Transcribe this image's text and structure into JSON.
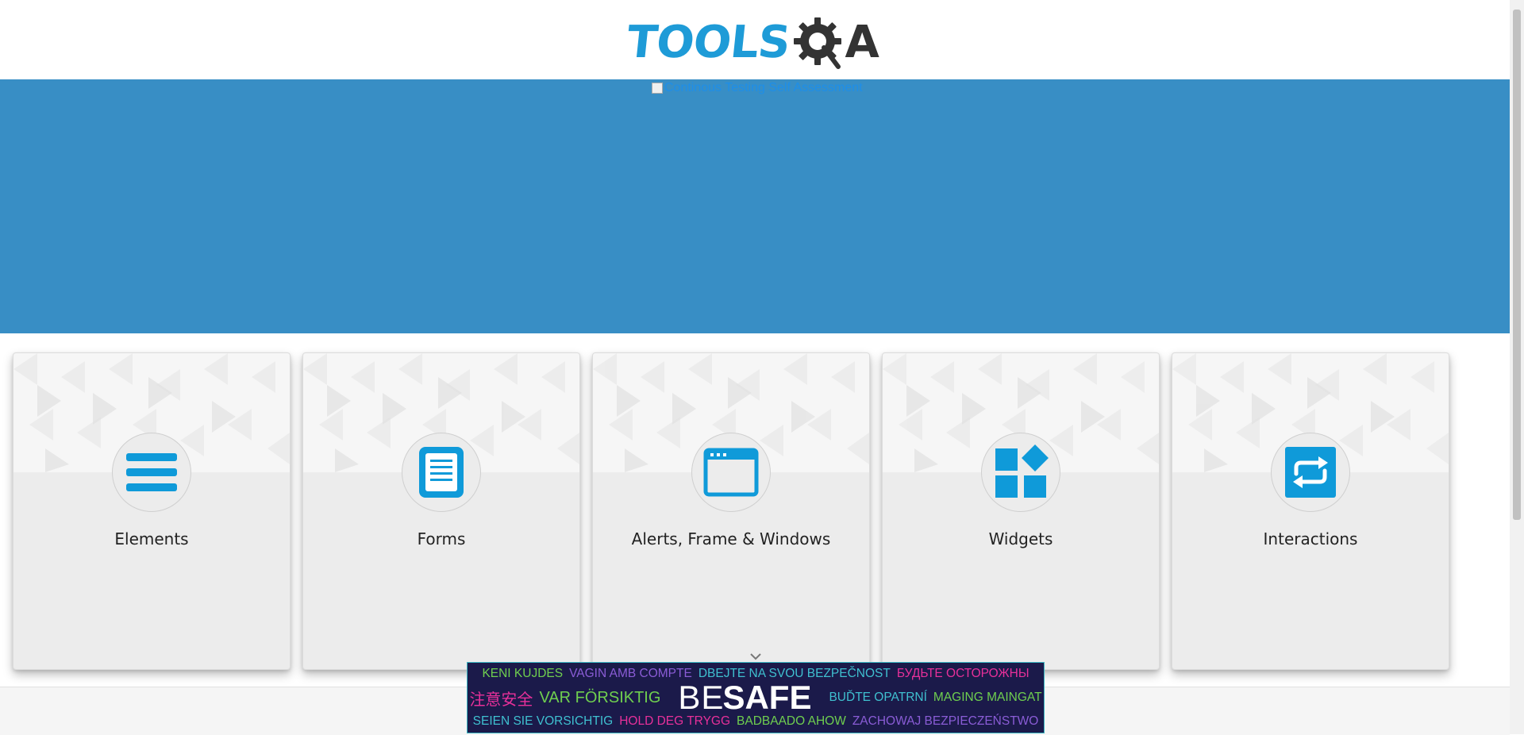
{
  "header": {
    "logo_text": "TOOLS",
    "logo_suffix": "A"
  },
  "banner": {
    "image_alt": "Continous Testing Self Assessment"
  },
  "cards": [
    {
      "title": "Elements",
      "icon": "hamburger-list-icon"
    },
    {
      "title": "Forms",
      "icon": "document-form-icon"
    },
    {
      "title": "Alerts, Frame & Windows",
      "icon": "browser-window-icon"
    },
    {
      "title": "Widgets",
      "icon": "widgets-blocks-icon"
    },
    {
      "title": "Interactions",
      "icon": "repeat-arrows-icon"
    }
  ],
  "ad": {
    "row1": [
      {
        "text": "KENI KUJDES",
        "color": "#6fcf4f"
      },
      {
        "text": "VAGIN AMB COMPTE",
        "color": "#8a5cd6"
      },
      {
        "text": "DBEJTE NA SVOU BEZPEČNOST",
        "color": "#3fc0d0"
      },
      {
        "text": "БУДЬТЕ ОСТОРОЖНЫ",
        "color": "#e8309a"
      }
    ],
    "row2_left": [
      {
        "text": "注意安全",
        "color": "#e8309a"
      },
      {
        "text": "VAR FÖRSIKTIG",
        "color": "#6fcf4f"
      }
    ],
    "be": "BE",
    "safe": "SAFE",
    "row2_right": [
      {
        "text": "BUĎTE OPATRNÍ",
        "color": "#3fc0d0"
      },
      {
        "text": "MAGING MAINGAT",
        "color": "#6fcf4f"
      }
    ],
    "row3": [
      {
        "text": "SEIEN SIE VORSICHTIG",
        "color": "#3fc0d0"
      },
      {
        "text": "HOLD DEG TRYGG",
        "color": "#e8309a"
      },
      {
        "text": "BADBAADO AHOW",
        "color": "#6fcf4f"
      },
      {
        "text": "ZACHOWAJ BEZPIECZEŃSTWO",
        "color": "#8a5cd6"
      }
    ]
  },
  "colors": {
    "brand_blue": "#1e9bd7",
    "banner_blue": "#388ec5",
    "icon_blue": "#0f9ad9",
    "card_bg": "#ececec"
  }
}
